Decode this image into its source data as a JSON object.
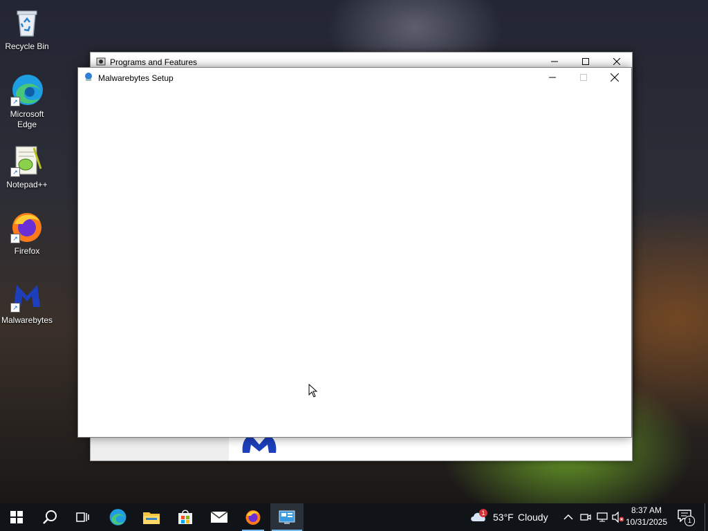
{
  "desktop": {
    "icons": [
      {
        "label": "Recycle Bin",
        "icon": "recycle-bin-icon"
      },
      {
        "label": "Microsoft Edge",
        "icon": "edge-icon"
      },
      {
        "label": "Notepad++",
        "icon": "notepadpp-icon"
      },
      {
        "label": "Firefox",
        "icon": "firefox-icon"
      },
      {
        "label": "Malwarebytes",
        "icon": "malwarebytes-icon"
      }
    ]
  },
  "windows": {
    "programs_and_features": {
      "title": "Programs and Features"
    },
    "malwarebytes_setup": {
      "title": "Malwarebytes Setup"
    }
  },
  "taskbar": {
    "buttons": [
      "start-icon",
      "search-icon",
      "task-view-icon",
      "edge-icon",
      "file-explorer-icon",
      "store-icon",
      "mail-icon",
      "firefox-icon",
      "control-panel-icon"
    ],
    "weather": {
      "temperature": "53°F",
      "condition": "Cloudy",
      "badge": "1"
    },
    "clock": {
      "time": "8:37 AM",
      "date": "10/31/2025"
    },
    "notifications": {
      "count": "1"
    }
  },
  "colors": {
    "taskbar": "#101418",
    "accent": "#76b9ed",
    "malwarebytes_blue": "#1d3fbb"
  }
}
